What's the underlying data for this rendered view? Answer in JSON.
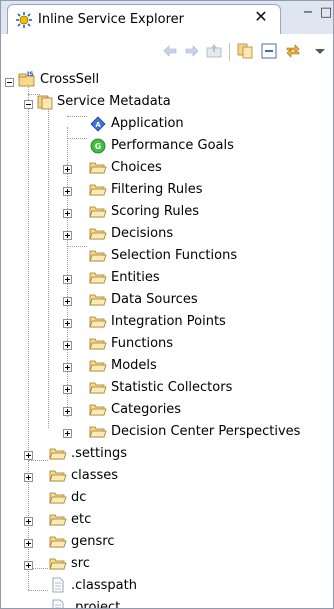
{
  "view": {
    "title": "Inline Service Explorer",
    "close_glyph": "✕",
    "minimize_glyph": "−",
    "maximize_glyph": "□",
    "tab_icon": "inline-service-icon",
    "toolbar": [
      "back-arrow-icon",
      "forward-arrow-icon",
      "up-folder-icon",
      "copy-icon",
      "collapse-all-icon",
      "link-with-editor-icon",
      "view-menu-icon"
    ]
  },
  "tree": {
    "root": {
      "label": "CrossSell",
      "icon": "project-is-icon"
    },
    "metadata": {
      "label": "Service Metadata",
      "icon": "metadata-icon"
    },
    "application": {
      "label": "Application",
      "icon": "application-icon"
    },
    "performance_goals": {
      "label": "Performance Goals",
      "icon": "goals-icon"
    },
    "choices": {
      "label": "Choices",
      "icon": "folder-icon"
    },
    "filtering_rules": {
      "label": "Filtering Rules",
      "icon": "folder-icon"
    },
    "scoring_rules": {
      "label": "Scoring Rules",
      "icon": "folder-icon"
    },
    "decisions": {
      "label": "Decisions",
      "icon": "folder-icon"
    },
    "selection_functions": {
      "label": "Selection Functions",
      "icon": "folder-icon"
    },
    "entities": {
      "label": "Entities",
      "icon": "folder-icon"
    },
    "data_sources": {
      "label": "Data Sources",
      "icon": "folder-icon"
    },
    "integration_points": {
      "label": "Integration Points",
      "icon": "folder-icon"
    },
    "functions": {
      "label": "Functions",
      "icon": "folder-icon"
    },
    "models": {
      "label": "Models",
      "icon": "folder-icon"
    },
    "statistic_collectors": {
      "label": "Statistic Collectors",
      "icon": "folder-icon"
    },
    "categories": {
      "label": "Categories",
      "icon": "folder-icon"
    },
    "dc_perspectives": {
      "label": "Decision Center Perspectives",
      "icon": "folder-icon"
    },
    "settings": {
      "label": ".settings",
      "icon": "folder-icon"
    },
    "classes": {
      "label": "classes",
      "icon": "folder-icon"
    },
    "dc": {
      "label": "dc",
      "icon": "folder-icon"
    },
    "etc": {
      "label": "etc",
      "icon": "folder-icon"
    },
    "gensrc": {
      "label": "gensrc",
      "icon": "folder-icon"
    },
    "src": {
      "label": "src",
      "icon": "folder-icon"
    },
    "classpath": {
      "label": ".classpath",
      "icon": "file-icon"
    },
    "project": {
      "label": ".project",
      "icon": "file-icon"
    }
  }
}
